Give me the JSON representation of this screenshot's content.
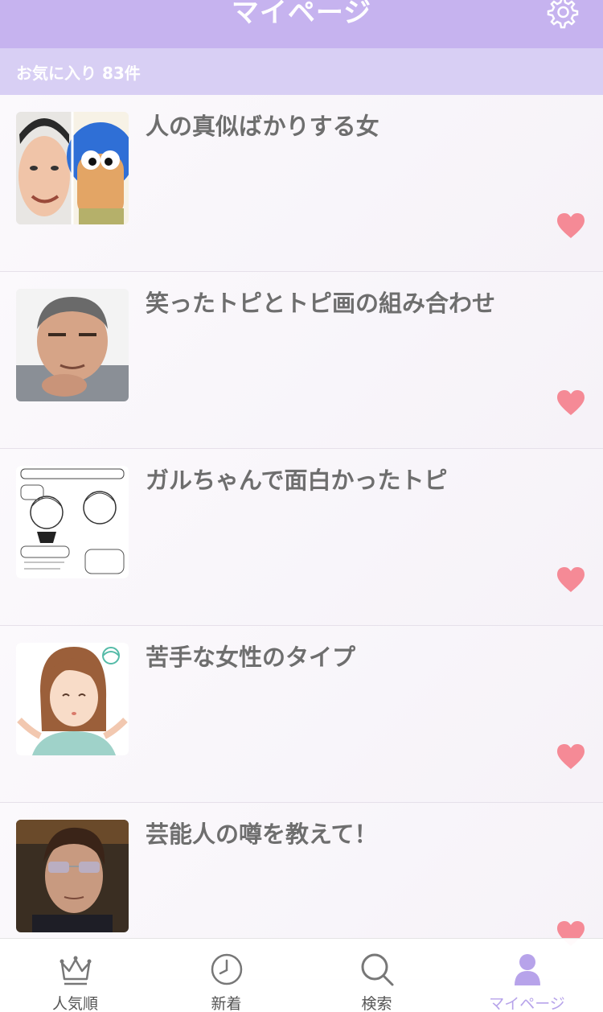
{
  "header": {
    "title": "マイページ",
    "settings_icon": "gear-icon"
  },
  "subheader": {
    "text": "お気に入り 83件"
  },
  "colors": {
    "header_bg": "#c6b3ef",
    "subheader_bg": "#d8cff4",
    "heart": "#f58a96",
    "active_tab": "#b7a3ea"
  },
  "favorites": [
    {
      "title": "人の真似ばかりする女",
      "thumbnail": "man-and-ninja-cartoon",
      "favorited": true
    },
    {
      "title": "笑ったトピとトピ画の組み合わせ",
      "thumbnail": "older-man-thinking",
      "favorited": true
    },
    {
      "title": "ガルちゃんで面白かったトピ",
      "thumbnail": "manga-sketch",
      "favorited": true
    },
    {
      "title": "苦手な女性のタイプ",
      "thumbnail": "woman-illustration",
      "favorited": true
    },
    {
      "title": "芸能人の噂を教えて！",
      "thumbnail": "man-with-sunglasses",
      "favorited": true
    }
  ],
  "tabbar": {
    "tabs": [
      {
        "label": "人気順",
        "icon": "crown-icon"
      },
      {
        "label": "新着",
        "icon": "clock-icon"
      },
      {
        "label": "検索",
        "icon": "search-icon"
      },
      {
        "label": "マイページ",
        "icon": "person-icon",
        "active": true
      }
    ]
  }
}
